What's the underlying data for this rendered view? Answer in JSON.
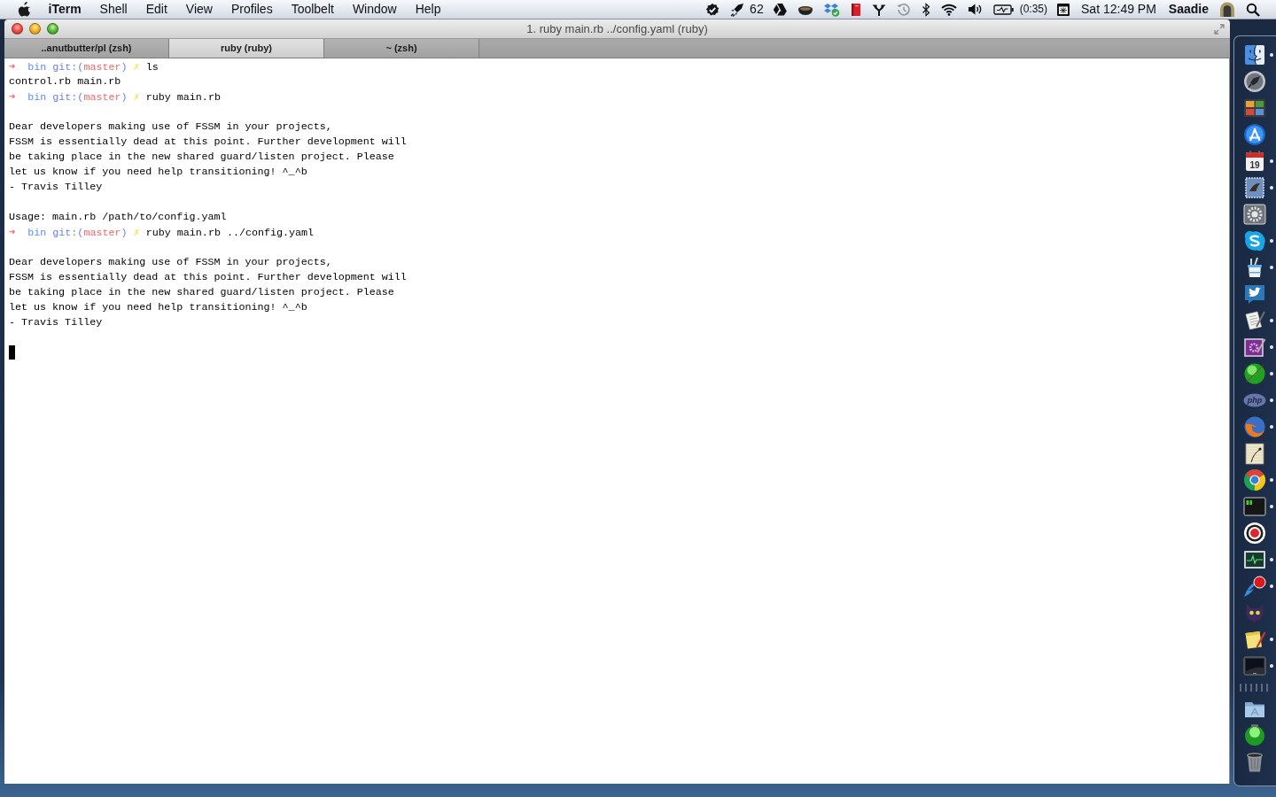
{
  "menu_bar": {
    "app_name": "iTerm",
    "menus": [
      "Shell",
      "Edit",
      "View",
      "Profiles",
      "Toolbelt",
      "Window",
      "Help"
    ],
    "notification_count": "62",
    "battery_time": "(0:35)",
    "clock": "Sat 12:49 PM",
    "user_name": "Saadie"
  },
  "window": {
    "title": "1. ruby main.rb ../config.yaml (ruby)",
    "tabs": [
      {
        "label": "..anutbutter/pl (zsh)",
        "selected": false
      },
      {
        "label": "ruby (ruby)",
        "selected": true
      },
      {
        "label": "~ (zsh)",
        "selected": false
      }
    ]
  },
  "terminal": {
    "lines": [
      {
        "kind": "prompt",
        "arrow": "➜",
        "dir": "bin",
        "git_open": "git:(",
        "branch": "master",
        "git_close": ")",
        "dirty": "✗",
        "command": "ls"
      },
      {
        "kind": "output",
        "text": "control.rb main.rb"
      },
      {
        "kind": "prompt",
        "arrow": "➜",
        "dir": "bin",
        "git_open": "git:(",
        "branch": "master",
        "git_close": ")",
        "dirty": "✗",
        "command": "ruby main.rb"
      },
      {
        "kind": "blank"
      },
      {
        "kind": "output",
        "text": "Dear developers making use of FSSM in your projects,"
      },
      {
        "kind": "output",
        "text": "FSSM is essentially dead at this point. Further development will"
      },
      {
        "kind": "output",
        "text": "be taking place in the new shared guard/listen project. Please"
      },
      {
        "kind": "output",
        "text": "let us know if you need help transitioning! ^_^b"
      },
      {
        "kind": "output",
        "text": "- Travis Tilley"
      },
      {
        "kind": "blank"
      },
      {
        "kind": "output",
        "text": "Usage: main.rb /path/to/config.yaml"
      },
      {
        "kind": "prompt",
        "arrow": "➜",
        "dir": "bin",
        "git_open": "git:(",
        "branch": "master",
        "git_close": ")",
        "dirty": "✗",
        "command": "ruby main.rb ../config.yaml"
      },
      {
        "kind": "blank"
      },
      {
        "kind": "output",
        "text": "Dear developers making use of FSSM in your projects,"
      },
      {
        "kind": "output",
        "text": "FSSM is essentially dead at this point. Further development will"
      },
      {
        "kind": "output",
        "text": "be taking place in the new shared guard/listen project. Please"
      },
      {
        "kind": "output",
        "text": "let us know if you need help transitioning! ^_^b"
      },
      {
        "kind": "output",
        "text": "- Travis Tilley"
      },
      {
        "kind": "blank"
      },
      {
        "kind": "cursor"
      }
    ]
  },
  "dock": {
    "apps": [
      {
        "running": true
      },
      {
        "running": false
      },
      {
        "running": false
      },
      {
        "running": false
      },
      {
        "running": true,
        "text": "19"
      },
      {
        "running": true
      },
      {
        "running": false
      },
      {
        "running": true
      },
      {
        "running": true
      },
      {
        "running": false
      },
      {
        "running": true
      },
      {
        "running": true
      },
      {
        "running": true
      },
      {
        "running": true,
        "text": "php"
      },
      {
        "running": true
      },
      {
        "running": false
      },
      {
        "running": true
      },
      {
        "running": true
      },
      {
        "running": false
      },
      {
        "running": true
      },
      {
        "running": true
      },
      {
        "running": false
      },
      {
        "running": true
      },
      {
        "running": true
      }
    ],
    "stacks": [
      {
        "running": false
      },
      {
        "running": false
      },
      {
        "running": false
      }
    ]
  }
}
